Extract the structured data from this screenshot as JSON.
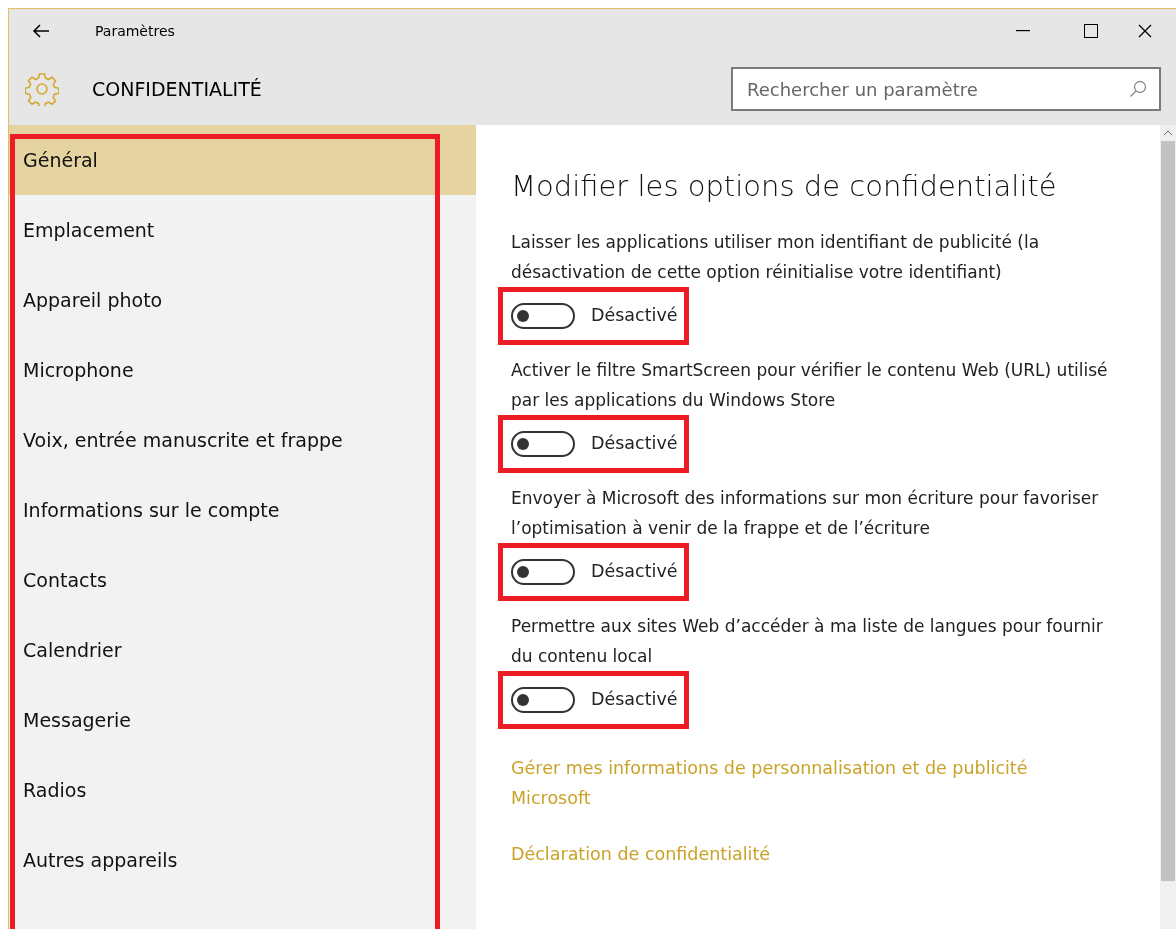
{
  "window": {
    "title": "Paramètres"
  },
  "header": {
    "title": "CONFIDENTIALITÉ",
    "search": {
      "placeholder": "Rechercher un paramètre"
    }
  },
  "sidebar": {
    "items": [
      {
        "label": "Général",
        "selected": true
      },
      {
        "label": "Emplacement",
        "selected": false
      },
      {
        "label": "Appareil photo",
        "selected": false
      },
      {
        "label": "Microphone",
        "selected": false
      },
      {
        "label": "Voix, entrée manuscrite et frappe",
        "selected": false
      },
      {
        "label": "Informations sur le compte",
        "selected": false
      },
      {
        "label": "Contacts",
        "selected": false
      },
      {
        "label": "Calendrier",
        "selected": false
      },
      {
        "label": "Messagerie",
        "selected": false
      },
      {
        "label": "Radios",
        "selected": false
      },
      {
        "label": "Autres appareils",
        "selected": false
      }
    ]
  },
  "content": {
    "heading": "Modifier les options de confidentialité",
    "options": [
      {
        "description": "Laisser les applications utiliser mon identifiant de publicité (la désactivation de cette option réinitialise votre identifiant)",
        "on": false,
        "state_label": "Désactivé"
      },
      {
        "description": "Activer le filtre SmartScreen pour vérifier le contenu Web (URL) utilisé par les applications du Windows Store",
        "on": false,
        "state_label": "Désactivé"
      },
      {
        "description": "Envoyer à Microsoft des informations sur mon écriture pour favoriser l’optimisation à venir de la frappe et de l’écriture",
        "on": false,
        "state_label": "Désactivé"
      },
      {
        "description": "Permettre aux sites Web d’accéder à ma liste de langues pour fournir du contenu local",
        "on": false,
        "state_label": "Désactivé"
      }
    ],
    "links": [
      "Gérer mes informations de personnalisation et de publicité Microsoft",
      "Déclaration de confidentialité"
    ]
  }
}
